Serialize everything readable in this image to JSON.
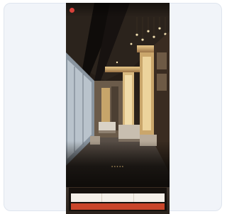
{
  "header": {
    "brand_color": "#d8413a",
    "nav_items": [
      "",
      "",
      ""
    ],
    "nav_right": [
      "",
      ""
    ]
  },
  "hero": {
    "stars": "★★★★★",
    "title": "",
    "title_tag": ""
  },
  "booking": {
    "heading_left": "",
    "heading_right": "",
    "fields": [
      {
        "label": "",
        "value": ""
      },
      {
        "label": "",
        "value": ""
      },
      {
        "label": "",
        "value": ""
      }
    ],
    "button_label": "",
    "button_color": "#c9452a"
  }
}
